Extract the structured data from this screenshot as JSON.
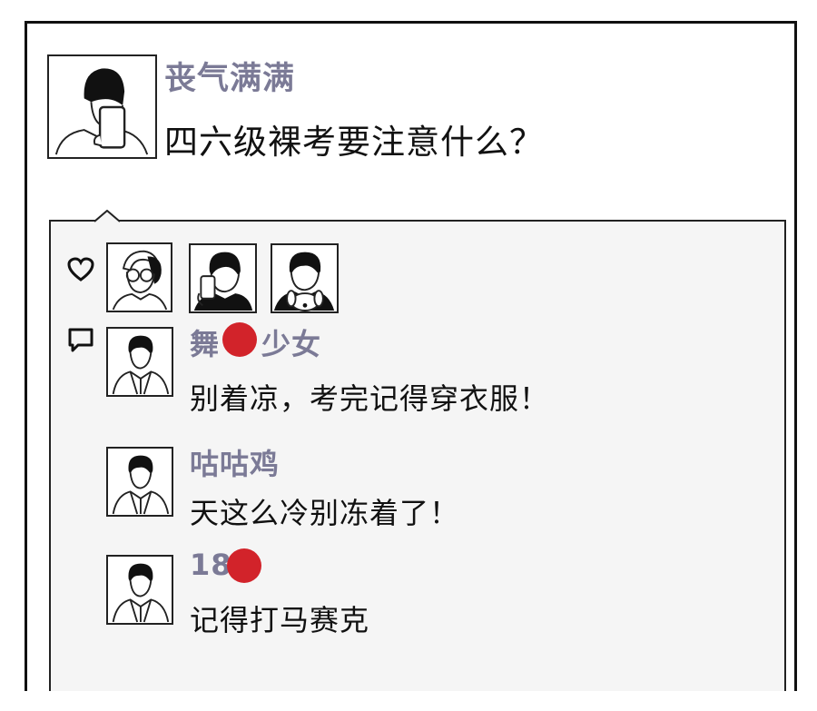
{
  "post": {
    "author": "丧气满满",
    "text": "四六级裸考要注意什么？"
  },
  "likes": {
    "icon": "heart-icon",
    "avatars": [
      "liker-avatar-glasses",
      "liker-avatar-phone",
      "liker-avatar-dog"
    ]
  },
  "comments": [
    {
      "name_visible": "舞",
      "name_visible_2": "少女",
      "text": "别着凉，考完记得穿衣服！",
      "redacted": true
    },
    {
      "name_visible": "咕咕鸡",
      "text": "天这么冷别冻着了！",
      "redacted": false
    },
    {
      "name_visible": "18",
      "text": "记得打马赛克",
      "redacted": true
    }
  ],
  "colors": {
    "name": "#7b7a96",
    "redact": "#d2232a",
    "panel_bg": "#f5f5f5"
  }
}
